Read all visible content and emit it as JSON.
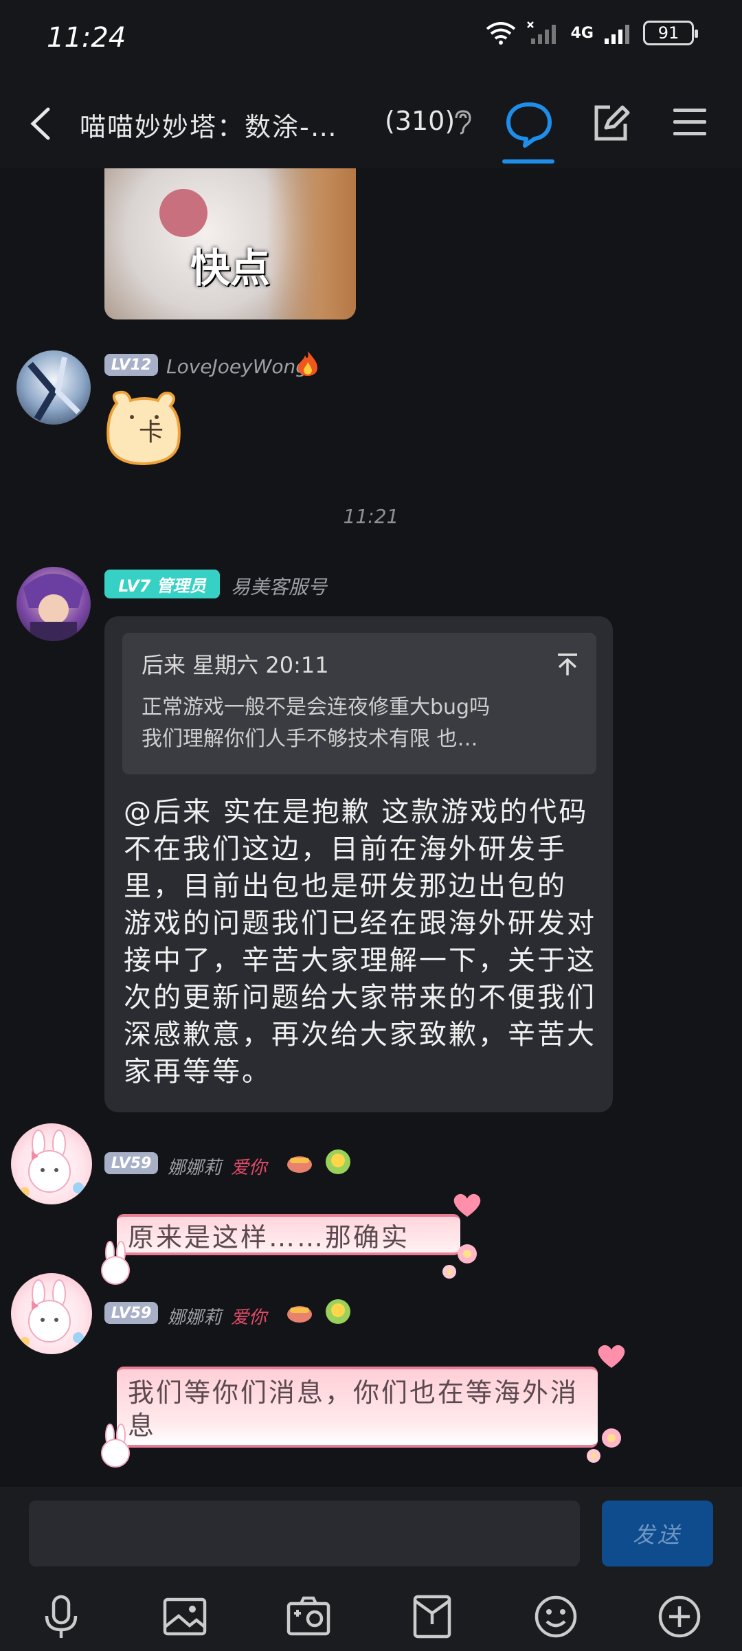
{
  "status_bar": {
    "time": "11:24",
    "network": "4G",
    "battery": "91"
  },
  "header": {
    "title": "喵喵妙妙塔：数涂-…",
    "member_count": "(310)"
  },
  "messages": {
    "sticker_caption": "快点",
    "m1": {
      "level": "LV12",
      "username": "LoveJoeyWong",
      "sticker_text": "卡"
    },
    "time_divider": "11:21",
    "m2": {
      "level": "LV7 管理员",
      "username": "易美客服号",
      "quote_author": "后来 星期六 20:11",
      "quote_line1": "正常游戏一般不是会连夜修重大bug吗",
      "quote_line2": "我们理解你们人手不够技术有限 也…",
      "text": "@后来 实在是抱歉 这款游戏的代码不在我们这边，目前在海外研发手里，目前出包也是研发那边出包的 游戏的问题我们已经在跟海外研发对接中了，辛苦大家理解一下，关于这次的更新问题给大家带来的不便我们深感歉意，再次给大家致歉，辛苦大家再等等。"
    },
    "m3": {
      "level": "LV59",
      "username": "娜娜莉",
      "tag": "爱你",
      "text": "原来是这样……那确实"
    },
    "m4": {
      "level": "LV59",
      "username": "娜娜莉",
      "tag": "爱你",
      "text": "我们等你们消息，你们也在等海外消息"
    }
  },
  "input": {
    "placeholder": "",
    "send_label": "发送"
  },
  "toolbar": {
    "icons": [
      "microphone-icon",
      "image-icon",
      "camera-icon",
      "red-packet-icon",
      "emoji-icon",
      "plus-icon"
    ]
  },
  "colors": {
    "accent": "#1f8eea",
    "send_button": "#0e4c8e",
    "admin_badge": "#36d1c4",
    "level_badge": "#a8b0c8"
  }
}
